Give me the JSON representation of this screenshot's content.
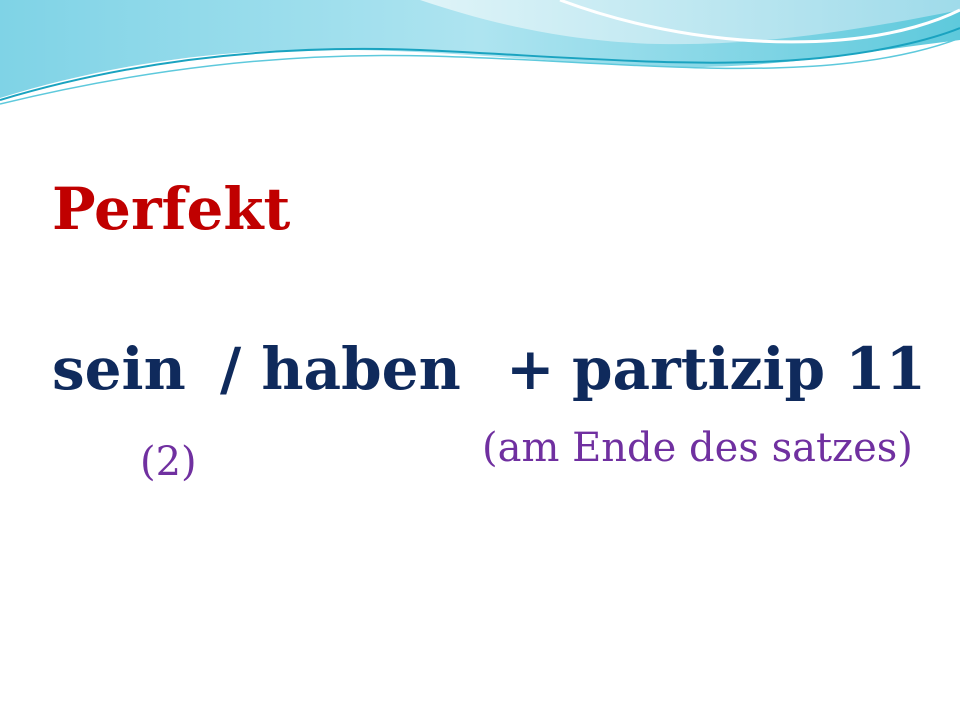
{
  "slide": {
    "title": "Perfekt",
    "formula": {
      "part1": "sein",
      "part2": "/ haben",
      "operator": "+",
      "part3": "partizip 11"
    },
    "notes": {
      "left": "(2)",
      "right": "(am Ende des satzes)"
    }
  },
  "colors": {
    "title": "#c00000",
    "formula": "#0f2a5c",
    "notes": "#7030a0",
    "wave_light": "#bfe9f2",
    "wave_mid": "#5ec9dc",
    "wave_dark": "#1aa3c0"
  }
}
